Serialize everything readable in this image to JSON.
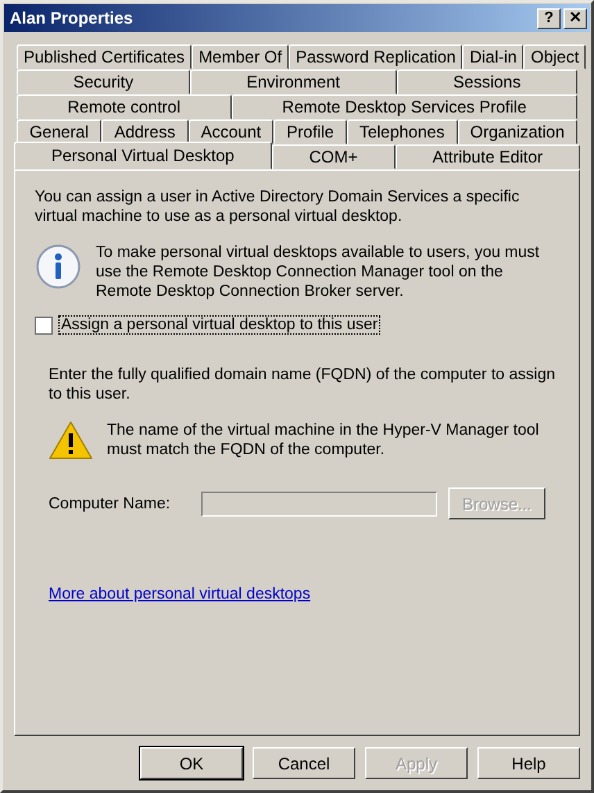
{
  "window": {
    "title": "Alan Properties",
    "help_button": "?",
    "close_button": "✕"
  },
  "tab_rows": [
    [
      {
        "label": "Published Certificates",
        "selected": false
      },
      {
        "label": "Member Of",
        "selected": false
      },
      {
        "label": "Password Replication",
        "selected": false
      },
      {
        "label": "Dial-in",
        "selected": false
      },
      {
        "label": "Object",
        "selected": false
      }
    ],
    [
      {
        "label": "Security",
        "selected": false
      },
      {
        "label": "Environment",
        "selected": false
      },
      {
        "label": "Sessions",
        "selected": false
      }
    ],
    [
      {
        "label": "Remote control",
        "selected": false
      },
      {
        "label": "Remote Desktop Services Profile",
        "selected": false
      }
    ],
    [
      {
        "label": "General",
        "selected": false
      },
      {
        "label": "Address",
        "selected": false
      },
      {
        "label": "Account",
        "selected": false
      },
      {
        "label": "Profile",
        "selected": false
      },
      {
        "label": "Telephones",
        "selected": false
      },
      {
        "label": "Organization",
        "selected": false
      }
    ],
    [
      {
        "label": "Personal Virtual Desktop",
        "selected": true
      },
      {
        "label": "COM+",
        "selected": false
      },
      {
        "label": "Attribute Editor",
        "selected": false
      }
    ]
  ],
  "intro": "You can assign a user in Active Directory Domain Services a specific virtual machine to use as a personal virtual desktop.",
  "info_note": "To make personal virtual desktops available to users, you must use the Remote Desktop Connection Manager tool on the Remote Desktop Connection Broker server.",
  "assign_checkbox": {
    "label": "Assign a personal virtual desktop to this user",
    "checked": false
  },
  "fqdn_text": "Enter the fully qualified domain name (FQDN) of the computer to assign to this user.",
  "warning_note": "The name of the virtual machine in the Hyper-V Manager tool must match the FQDN of the computer.",
  "computer_name": {
    "label": "Computer Name:",
    "disabled": true,
    "browse": {
      "label": "Browse...",
      "disabled": true
    }
  },
  "link": "More about personal virtual desktops",
  "buttons": [
    {
      "label": "OK",
      "default": true,
      "disabled": false
    },
    {
      "label": "Cancel",
      "default": false,
      "disabled": false
    },
    {
      "label": "Apply",
      "default": false,
      "disabled": true
    },
    {
      "label": "Help",
      "default": false,
      "disabled": false
    }
  ]
}
